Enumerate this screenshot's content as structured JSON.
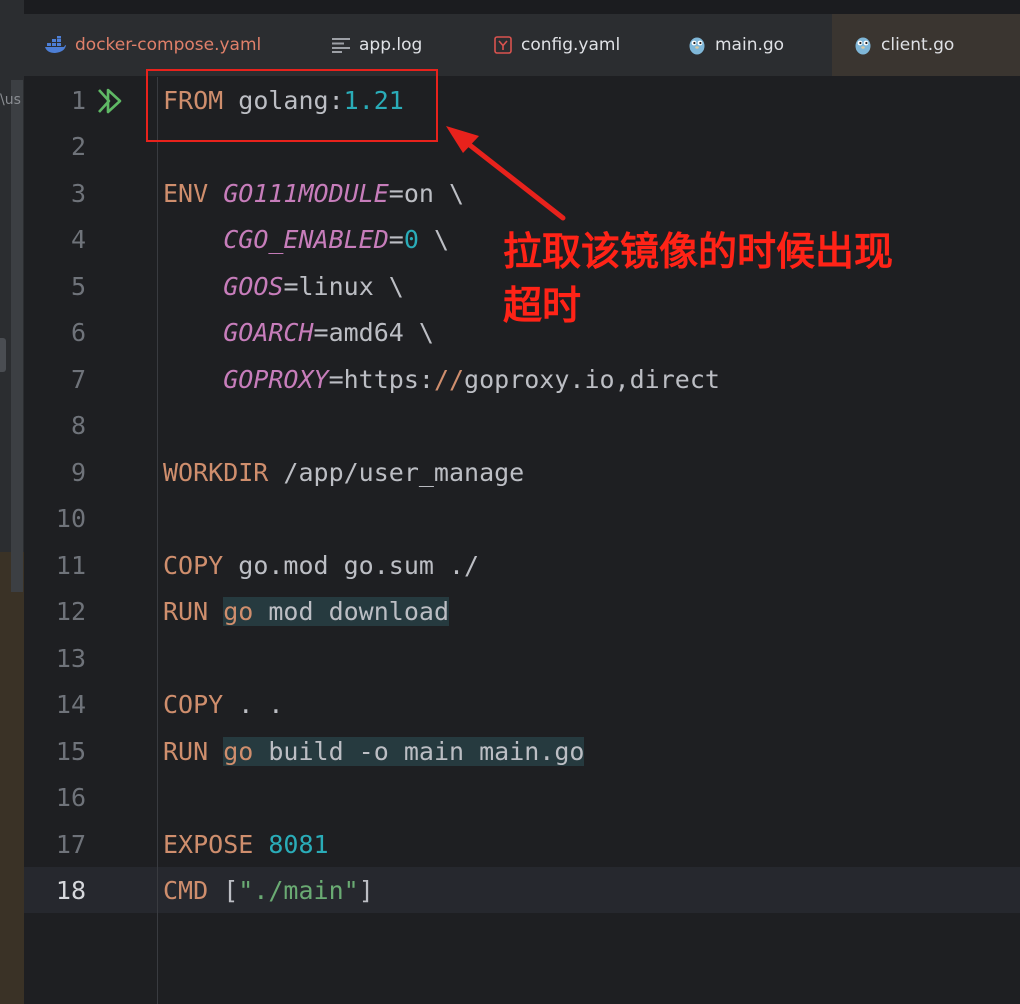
{
  "window": {
    "left_panel_path_fragment": "\\us"
  },
  "tabs": [
    {
      "label": "docker-compose.yaml",
      "icon": "docker-icon"
    },
    {
      "label": "app.log",
      "icon": "log-file-icon"
    },
    {
      "label": "config.yaml",
      "icon": "yaml-icon"
    },
    {
      "label": "main.go",
      "icon": "gopher-icon"
    },
    {
      "label": "client.go",
      "icon": "gopher-icon",
      "active": true
    }
  ],
  "editor": {
    "current_line": 18,
    "line_numbers": [
      "1",
      "2",
      "3",
      "4",
      "5",
      "6",
      "7",
      "8",
      "9",
      "10",
      "11",
      "12",
      "13",
      "14",
      "15",
      "16",
      "17",
      "18"
    ],
    "code": {
      "l1_kw": "FROM",
      "l1_img": " golang:",
      "l1_ver": "1.21",
      "l3_kw": "ENV",
      "l3_var": "GO111MODULE",
      "l3_val": "=on \\",
      "l4_indent": "    ",
      "l4_var": "CGO_ENABLED",
      "l4_eq": "=",
      "l4_num": "0",
      "l4_tail": " \\",
      "l5_indent": "    ",
      "l5_var": "GOOS",
      "l5_val": "=linux \\",
      "l6_indent": "    ",
      "l6_var": "GOARCH",
      "l6_val": "=amd64 \\",
      "l7_indent": "    ",
      "l7_var": "GOPROXY",
      "l7_a": "=https:",
      "l7_slashes": "//",
      "l7_b": "goproxy.io,direct",
      "l9_kw": "WORKDIR",
      "l9_rest": " /app/user_manage",
      "l11_kw": "COPY",
      "l11_rest": " go.mod go.sum ./",
      "l12_kw": "RUN",
      "l12_go": "go",
      "l12_rest": " mod download",
      "l14_kw": "COPY",
      "l14_rest": " . .",
      "l15_kw": "RUN",
      "l15_go": "go",
      "l15_rest": " build -o main main.go",
      "l17_kw": "EXPOSE",
      "l17_num": "8081",
      "l18_kw": "CMD",
      "l18_open": " [",
      "l18_str": "\"./main\"",
      "l18_close": "]"
    }
  },
  "annotation": {
    "text_line1": "拉取该镜像的时候出现",
    "text_line2": "超时",
    "color": "#ff2317"
  },
  "colors": {
    "keyword": "#cf8e6d",
    "number": "#2aacb8",
    "env_var": "#c77dbb",
    "string": "#6aab73",
    "background": "#1e1f22"
  }
}
